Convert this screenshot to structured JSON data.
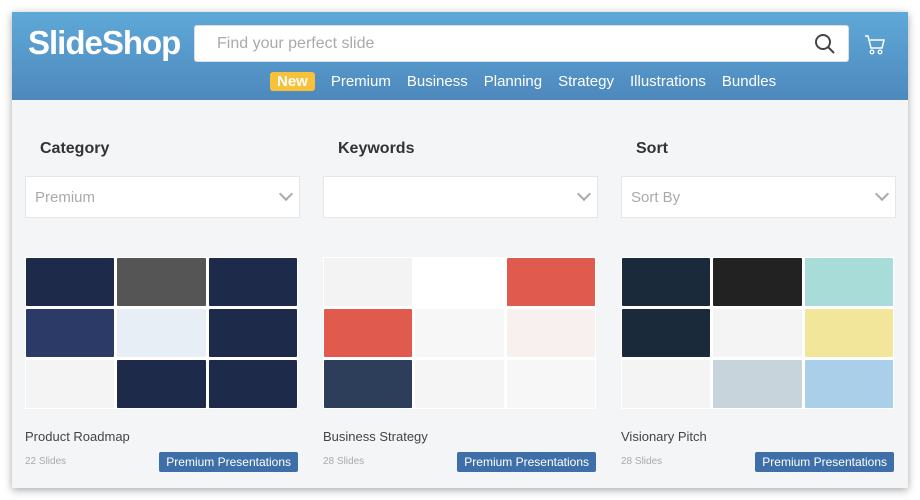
{
  "header": {
    "logo": "SlideShop",
    "search_placeholder": "Find your perfect slide",
    "nav": [
      "New",
      "Premium",
      "Business",
      "Planning",
      "Strategy",
      "Illustrations",
      "Bundles"
    ]
  },
  "filters": {
    "category_label": "Category",
    "category_value": "Premium",
    "keywords_label": "Keywords",
    "keywords_value": "",
    "sort_label": "Sort",
    "sort_value": "Sort By"
  },
  "cards": [
    {
      "title": "Product Roadmap",
      "slides": "22 Slides",
      "badge": "Premium Presentations",
      "tiles": [
        "#1d2a4a",
        "#555",
        "#1d2a4a",
        "#2b3a66",
        "#e8eef5",
        "#1d2a4a",
        "#f4f4f4",
        "#1d2a4a",
        "#1d2a4a"
      ]
    },
    {
      "title": "Business Strategy",
      "slides": "28 Slides",
      "badge": "Premium Presentations",
      "tiles": [
        "#f3f3f3",
        "#fff",
        "#e05a4e",
        "#e05a4e",
        "#f7f7f7",
        "#f8f0ee",
        "#2c3e5a",
        "#f5f5f5",
        "#f7f7f7"
      ]
    },
    {
      "title": "Visionary Pitch",
      "slides": "28 Slides",
      "badge": "Premium Presentations",
      "tiles": [
        "#1b2a3a",
        "#222",
        "#a8dcd8",
        "#1b2a3a",
        "#f4f4f4",
        "#f1e69a",
        "#f4f4f4",
        "#c8d4dc",
        "#a9d0e8"
      ]
    }
  ],
  "colors": {
    "header_top": "#5ea9d8",
    "header_bottom": "#4e88bd",
    "new_badge": "#f7c23a",
    "badge": "#3e6fa8"
  }
}
